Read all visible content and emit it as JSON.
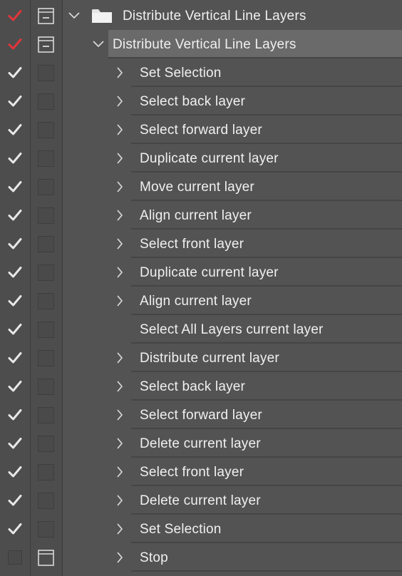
{
  "colors": {
    "enabled_check": "#e8e8e8",
    "dialog_on_check": "#e0363b",
    "icon_stroke": "#d9d9d9"
  },
  "rows": [
    {
      "label": "Distribute Vertical Line Layers",
      "check": "red",
      "dialog": "on",
      "toggle": "down",
      "kind": "set",
      "depth": 0
    },
    {
      "label": "Distribute Vertical Line Layers",
      "check": "red",
      "dialog": "on",
      "toggle": "down",
      "kind": "action",
      "depth": 1,
      "selected": true
    },
    {
      "label": "Set Selection",
      "check": "white",
      "dialog": "off",
      "toggle": "right",
      "kind": "command",
      "depth": 2
    },
    {
      "label": "Select back layer",
      "check": "white",
      "dialog": "off",
      "toggle": "right",
      "kind": "command",
      "depth": 2
    },
    {
      "label": "Select forward layer",
      "check": "white",
      "dialog": "off",
      "toggle": "right",
      "kind": "command",
      "depth": 2
    },
    {
      "label": "Duplicate current layer",
      "check": "white",
      "dialog": "off",
      "toggle": "right",
      "kind": "command",
      "depth": 2
    },
    {
      "label": "Move current layer",
      "check": "white",
      "dialog": "off",
      "toggle": "right",
      "kind": "command",
      "depth": 2
    },
    {
      "label": "Align current layer",
      "check": "white",
      "dialog": "off",
      "toggle": "right",
      "kind": "command",
      "depth": 2
    },
    {
      "label": "Select front layer",
      "check": "white",
      "dialog": "off",
      "toggle": "right",
      "kind": "command",
      "depth": 2
    },
    {
      "label": "Duplicate current layer",
      "check": "white",
      "dialog": "off",
      "toggle": "right",
      "kind": "command",
      "depth": 2
    },
    {
      "label": "Align current layer",
      "check": "white",
      "dialog": "off",
      "toggle": "right",
      "kind": "command",
      "depth": 2
    },
    {
      "label": "Select All Layers current layer",
      "check": "white",
      "dialog": "off",
      "toggle": "none",
      "kind": "command",
      "depth": 2
    },
    {
      "label": "Distribute current layer",
      "check": "white",
      "dialog": "off",
      "toggle": "right",
      "kind": "command",
      "depth": 2
    },
    {
      "label": "Select back layer",
      "check": "white",
      "dialog": "off",
      "toggle": "right",
      "kind": "command",
      "depth": 2
    },
    {
      "label": "Select forward layer",
      "check": "white",
      "dialog": "off",
      "toggle": "right",
      "kind": "command",
      "depth": 2
    },
    {
      "label": "Delete current layer",
      "check": "white",
      "dialog": "off",
      "toggle": "right",
      "kind": "command",
      "depth": 2
    },
    {
      "label": "Select front layer",
      "check": "white",
      "dialog": "off",
      "toggle": "right",
      "kind": "command",
      "depth": 2
    },
    {
      "label": "Delete current layer",
      "check": "white",
      "dialog": "off",
      "toggle": "right",
      "kind": "command",
      "depth": 2
    },
    {
      "label": "Set Selection",
      "check": "white",
      "dialog": "off",
      "toggle": "right",
      "kind": "command",
      "depth": 2
    },
    {
      "label": "Stop",
      "check": "empty",
      "dialog": "stop",
      "toggle": "right",
      "kind": "command",
      "depth": 2
    }
  ]
}
